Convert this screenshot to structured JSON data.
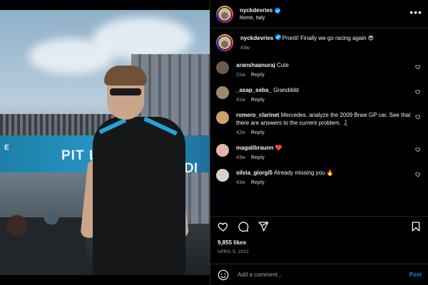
{
  "photo": {
    "banner_text": "PIT L",
    "banner_text_right": "DI",
    "banner_small": "E"
  },
  "post": {
    "username": "nyckdevries",
    "location": "Rome, Italy",
    "more_icon": "more-horizontal-icon",
    "caption": {
      "username": "nyckdevries",
      "text": "Pronti! Finally we go racing again 😎",
      "age": "43w"
    },
    "comments": [
      {
        "username": "aranshaanuraj",
        "text": "Cute",
        "age": "21w",
        "reply_label": "Reply",
        "avatar_color": "#6b5a4e"
      },
      {
        "username": "_asap_seba_",
        "text": "Grandddd",
        "age": "41w",
        "reply_label": "Reply",
        "avatar_color": "#9b8b6b"
      },
      {
        "username": "romero_clarinet",
        "text": "Mercedes. analyze the 2009 Braw GP car. See that there are answers to the current problem. 🧎‍♀️",
        "age": "42w",
        "reply_label": "Reply",
        "avatar_color": "#c9a46a"
      },
      {
        "username": "magalibraunn",
        "text": "❤️",
        "age": "43w",
        "reply_label": "Reply",
        "avatar_color": "#e0b6a6"
      },
      {
        "username": "silvia_giorgi5",
        "text": "Already missing you 🔥",
        "age": "43w",
        "reply_label": "Reply",
        "avatar_color": "#d7d2cc"
      }
    ],
    "likes": "9,855 likes",
    "date": "APRIL 9, 2022",
    "add_comment_placeholder": "Add a comment...",
    "post_label": "Post",
    "icons": {
      "like": "heart-icon",
      "comment": "comment-icon",
      "share": "share-icon",
      "save": "bookmark-icon",
      "emoji": "emoji-icon"
    }
  },
  "colors": {
    "background": "#000000",
    "text": "#f5f5f5",
    "secondary_text": "#a8a8a8",
    "accent": "#0095f6",
    "divider": "#262626"
  }
}
